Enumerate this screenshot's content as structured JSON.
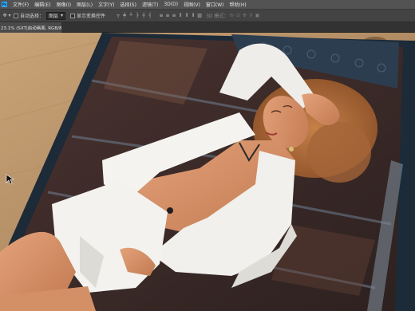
{
  "menu": {
    "logo": "Ps",
    "items": [
      "文件(F)",
      "编辑(E)",
      "图像(I)",
      "图层(L)",
      "文字(Y)",
      "选择(S)",
      "滤镜(T)",
      "3D(D)",
      "视图(V)",
      "窗口(W)",
      "帮助(H)"
    ]
  },
  "options": {
    "auto_select_label": "自动选择：",
    "auto_select_value": "图层",
    "show_transform_label": "显示变换控件",
    "mode_label": "3D 模式："
  },
  "document": {
    "tab_title": "23.1% (SXT|启动画面, RGB/8) *",
    "close_symbol": "×"
  },
  "colors": {
    "menubar": "#535353",
    "optionsbar": "#434343",
    "tab_active": "#4a4a4a",
    "wood": "#3a2a25",
    "blazer": "#f1f0ec"
  }
}
